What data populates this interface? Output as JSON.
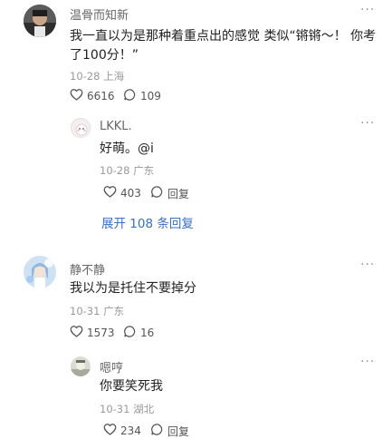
{
  "comments": [
    {
      "name": "温骨而知新",
      "text_line1": "我一直以为是那种着重点出的感觉 类似“锵锵～！ 你考",
      "text_line2": "了100分！”",
      "meta": "10-28 上海",
      "likes": "6616",
      "replies_count": "109",
      "reply": {
        "name": "LKKL.",
        "text": "好萌。@i",
        "meta": "10-28 广东",
        "likes": "403",
        "reply_label": "回复"
      },
      "expand_label": "展开 108 条回复"
    },
    {
      "name": "静不静",
      "text": "我以为是托住不要掉分",
      "meta": "10-31 广东",
      "likes": "1573",
      "replies_count": "16",
      "reply": {
        "name": "嗯哼",
        "text": "你要笑死我",
        "meta": "10-31 湖北",
        "likes": "234",
        "reply_label": "回复"
      }
    }
  ],
  "more_glyph": "···"
}
